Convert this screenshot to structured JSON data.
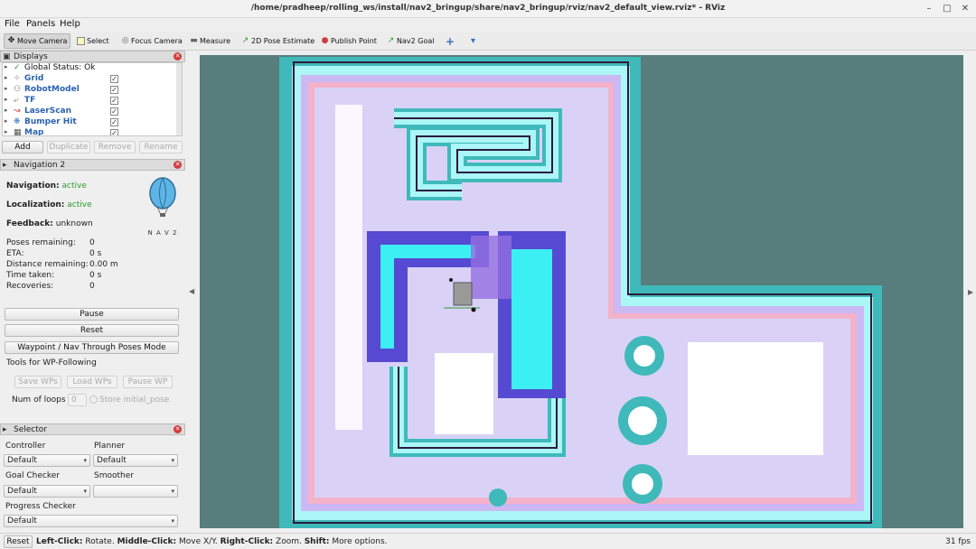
{
  "window": {
    "title": "/home/pradheep/rolling_ws/install/nav2_bringup/share/nav2_bringup/rviz/nav2_default_view.rviz* - RViz"
  },
  "menu": {
    "file": "File",
    "panels": "Panels",
    "help": "Help"
  },
  "toolbar": {
    "move_camera": "Move Camera",
    "select": "Select",
    "focus_camera": "Focus Camera",
    "measure": "Measure",
    "pose_estimate": "2D Pose Estimate",
    "publish_point": "Publish Point",
    "nav2_goal": "Nav2 Goal"
  },
  "displays": {
    "title": "Displays",
    "items": [
      {
        "label": "Global Status: Ok",
        "icon": "check-icon"
      },
      {
        "label": "Grid",
        "icon": "grid-icon",
        "checked": true
      },
      {
        "label": "RobotModel",
        "icon": "robot-icon",
        "checked": true
      },
      {
        "label": "TF",
        "icon": "tf-icon",
        "checked": true
      },
      {
        "label": "LaserScan",
        "icon": "laser-icon",
        "checked": true
      },
      {
        "label": "Bumper Hit",
        "icon": "bumper-icon",
        "checked": true
      },
      {
        "label": "Map",
        "icon": "map-icon",
        "checked": true
      }
    ],
    "buttons": {
      "add": "Add",
      "duplicate": "Duplicate",
      "remove": "Remove",
      "rename": "Rename"
    }
  },
  "navigation": {
    "title": "Navigation 2",
    "navigation_label": "Navigation:",
    "navigation_value": "active",
    "localization_label": "Localization:",
    "localization_value": "active",
    "feedback_label": "Feedback:",
    "feedback_value": "unknown",
    "logo_text": "N A V 2",
    "poses_label": "Poses remaining:",
    "poses_value": "0",
    "eta_label": "ETA:",
    "eta_value": "0 s",
    "distance_label": "Distance remaining:",
    "distance_value": "0.00 m",
    "time_label": "Time taken:",
    "time_value": "0 s",
    "recoveries_label": "Recoveries:",
    "recoveries_value": "0",
    "pause": "Pause",
    "reset": "Reset",
    "waypoint_mode": "Waypoint / Nav Through Poses Mode",
    "tools_label": "Tools for WP-Following",
    "save_wps": "Save WPs",
    "load_wps": "Load WPs",
    "pause_wp": "Pause WP",
    "loops_label": "Num of loops",
    "loops_value": "0",
    "store_pose": "Store initial_pose"
  },
  "selector": {
    "title": "Selector",
    "controller_label": "Controller",
    "controller_value": "Default",
    "planner_label": "Planner",
    "planner_value": "Default",
    "goal_checker_label": "Goal Checker",
    "goal_checker_value": "Default",
    "smoother_label": "Smoother",
    "smoother_value": "",
    "progress_checker_label": "Progress Checker",
    "progress_checker_value": "Default"
  },
  "status": {
    "reset": "Reset",
    "left_click": "Left-Click:",
    "left_text": " Rotate. ",
    "middle_click": "Middle-Click:",
    "middle_text": " Move X/Y. ",
    "right_click": "Right-Click:",
    "right_text": " Zoom. ",
    "shift": "Shift:",
    "shift_text": " More options.",
    "fps": "31 fps"
  },
  "colors": {
    "viewport_bg": "#577d7d",
    "cost_teal": "#3bb6b6",
    "cost_cyan": "#aef8f8",
    "cost_pink": "#f2b0c8",
    "cost_lavender": "#c9b8f4",
    "free": "#ffffff",
    "wall": "#2b1b3b"
  }
}
